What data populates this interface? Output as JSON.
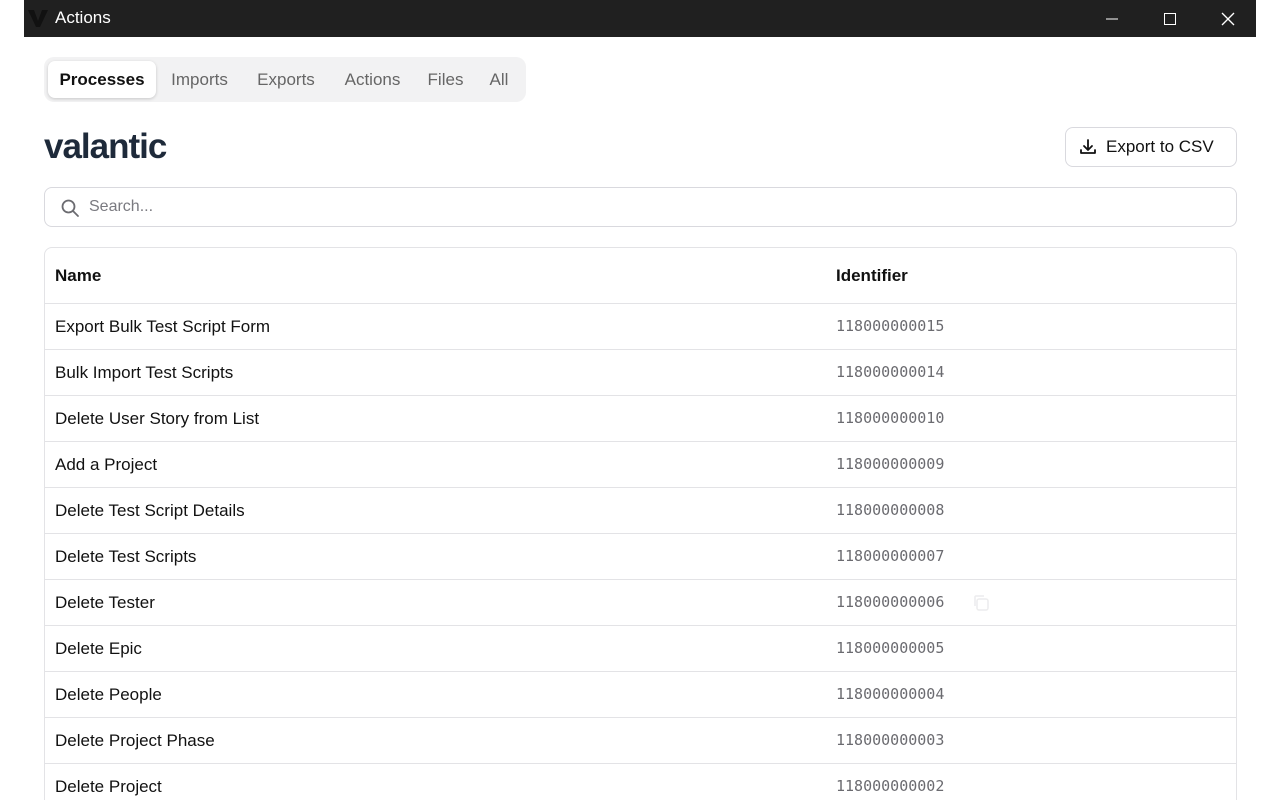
{
  "window": {
    "title": "Actions",
    "app_icon": "valantic-v-logo",
    "controls": [
      "minimize-icon",
      "maximize-icon",
      "close-icon"
    ]
  },
  "tabs": [
    {
      "label": "Processes",
      "active": true
    },
    {
      "label": "Imports",
      "active": false
    },
    {
      "label": "Exports",
      "active": false
    },
    {
      "label": "Actions",
      "active": false
    },
    {
      "label": "Files",
      "active": false
    },
    {
      "label": "All",
      "active": false
    }
  ],
  "brand": {
    "text": "valantic"
  },
  "export": {
    "label": "Export to CSV",
    "icon": "download-icon"
  },
  "search": {
    "placeholder": "Search...",
    "value": "",
    "icon": "search-icon"
  },
  "table": {
    "columns": {
      "name": "Name",
      "identifier": "Identifier"
    },
    "rows": [
      {
        "name": "Export Bulk Test Script Form",
        "identifier": "118000000015"
      },
      {
        "name": "Bulk Import Test Scripts",
        "identifier": "118000000014"
      },
      {
        "name": "Delete User Story from List",
        "identifier": "118000000010"
      },
      {
        "name": "Add a Project",
        "identifier": "118000000009"
      },
      {
        "name": "Delete Test Script Details",
        "identifier": "118000000008"
      },
      {
        "name": "Delete Test Scripts",
        "identifier": "118000000007"
      },
      {
        "name": "Delete Tester",
        "identifier": "118000000006",
        "copy_icon": "copy-icon"
      },
      {
        "name": "Delete Epic",
        "identifier": "118000000005"
      },
      {
        "name": "Delete People",
        "identifier": "118000000004"
      },
      {
        "name": "Delete Project Phase",
        "identifier": "118000000003"
      },
      {
        "name": "Delete Project",
        "identifier": "118000000002"
      }
    ]
  },
  "colors": {
    "titlebar": "#202020",
    "brand": "#1e2a3a",
    "border": "#e3e3e6",
    "tabs_bg": "#f2f2f3",
    "identifier_text": "#6b6b70"
  }
}
